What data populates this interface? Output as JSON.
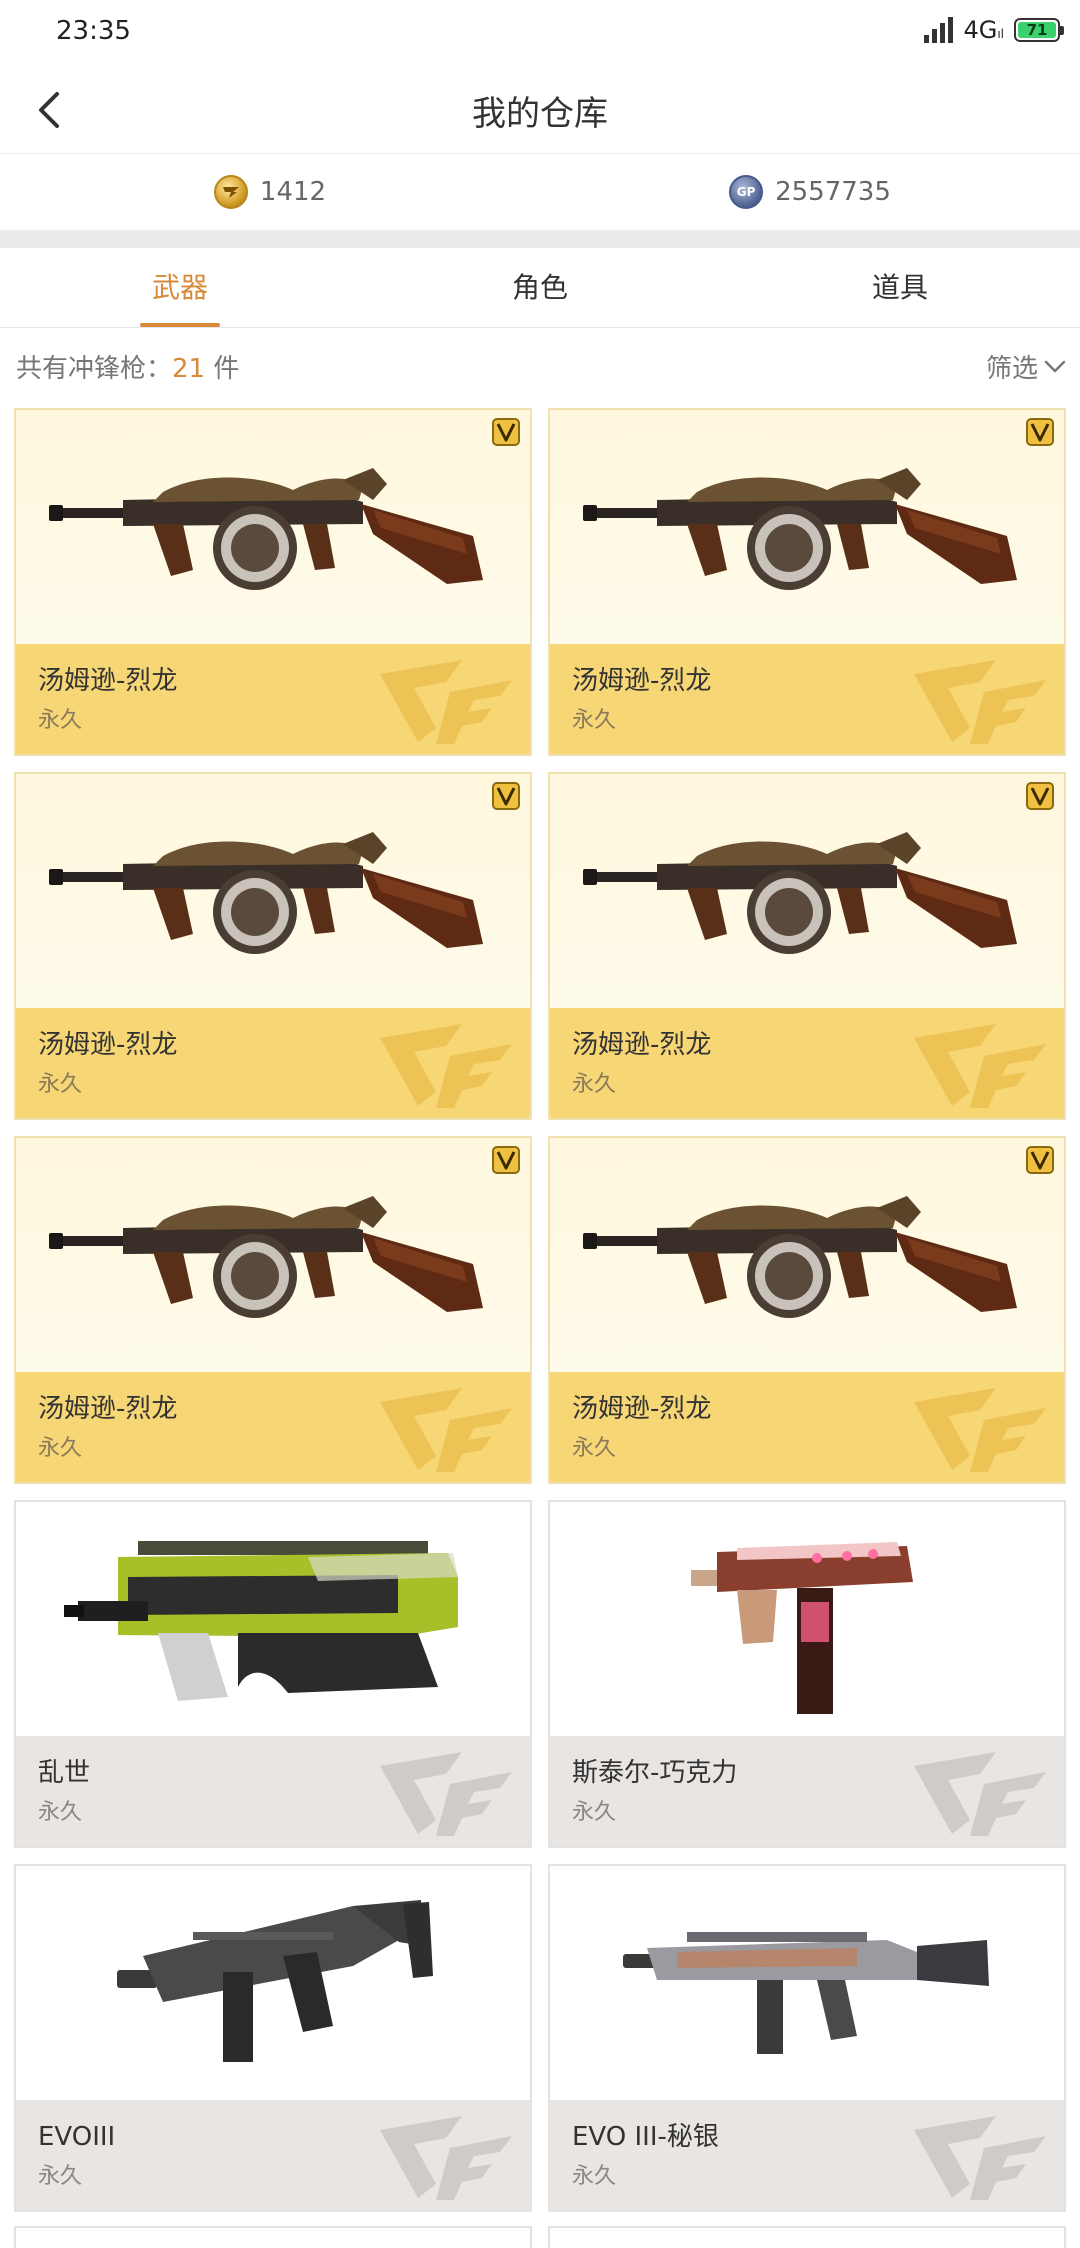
{
  "status": {
    "time": "23:35",
    "network": "4G",
    "network_sub": "ıl",
    "battery": "71"
  },
  "nav": {
    "title": "我的仓库"
  },
  "currency": [
    {
      "icon": "gold-coin-icon",
      "value": "1412"
    },
    {
      "icon": "gp-coin-icon",
      "label": "GP",
      "value": "2557735"
    }
  ],
  "tabs": [
    {
      "label": "武器",
      "active": true
    },
    {
      "label": "角色",
      "active": false
    },
    {
      "label": "道具",
      "active": false
    }
  ],
  "count": {
    "prefix": "共有冲锋枪：",
    "number": "21",
    "suffix": " 件"
  },
  "filter": {
    "label": "筛选"
  },
  "items": [
    {
      "name": "汤姆逊-烈龙",
      "duration": "永久",
      "rarity": "gold",
      "weapon": "thompson",
      "vip": true
    },
    {
      "name": "汤姆逊-烈龙",
      "duration": "永久",
      "rarity": "gold",
      "weapon": "thompson",
      "vip": true
    },
    {
      "name": "汤姆逊-烈龙",
      "duration": "永久",
      "rarity": "gold",
      "weapon": "thompson",
      "vip": true
    },
    {
      "name": "汤姆逊-烈龙",
      "duration": "永久",
      "rarity": "gold",
      "weapon": "thompson",
      "vip": true
    },
    {
      "name": "汤姆逊-烈龙",
      "duration": "永久",
      "rarity": "gold",
      "weapon": "thompson",
      "vip": true
    },
    {
      "name": "汤姆逊-烈龙",
      "duration": "永久",
      "rarity": "gold",
      "weapon": "thompson",
      "vip": true
    },
    {
      "name": "乱世",
      "duration": "永久",
      "rarity": "gray",
      "weapon": "p90",
      "vip": false
    },
    {
      "name": "斯泰尔-巧克力",
      "duration": "永久",
      "rarity": "gray",
      "weapon": "tmp",
      "vip": false
    },
    {
      "name": "EVOIII",
      "duration": "永久",
      "rarity": "gray",
      "weapon": "evo",
      "vip": false
    },
    {
      "name": "EVO III-秘银",
      "duration": "永久",
      "rarity": "gray",
      "weapon": "evo-silver",
      "vip": false
    }
  ],
  "colors": {
    "accent": "#d8893a",
    "gold_info": "#f7d676",
    "gray_info": "#e8e5e2"
  }
}
